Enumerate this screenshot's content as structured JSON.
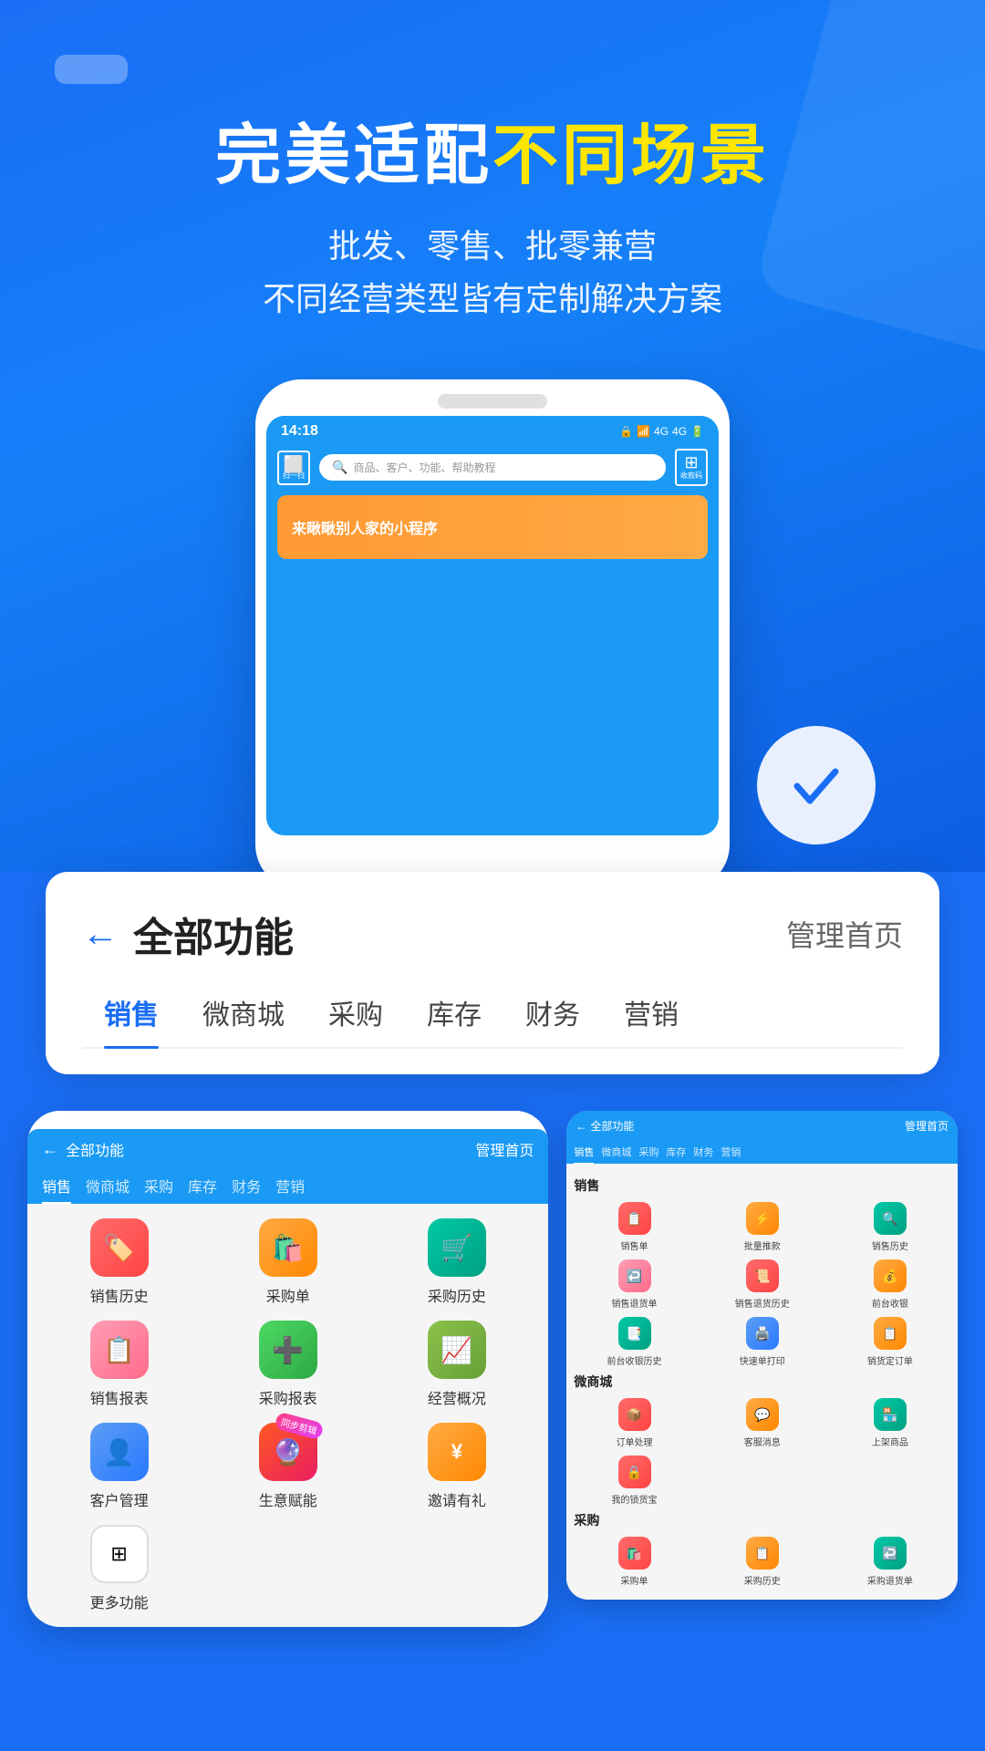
{
  "app": {
    "title": "完美适配不同场景"
  },
  "hero": {
    "headline_white": "完美适配",
    "headline_yellow": "不同场景",
    "subline1": "批发、零售、批零兼营",
    "subline2": "不同经营类型皆有定制解决方案"
  },
  "phone_mock": {
    "time": "14:18",
    "search_placeholder": "商品、客户、功能、帮助教程",
    "scan_label": "扫一扫",
    "qr_label": "收款码",
    "banner_text": "来瞅瞅别人家的小程序"
  },
  "feature_card": {
    "back_label": "←",
    "title": "全部功能",
    "manage_label": "管理首页",
    "tabs": [
      "销售",
      "微商城",
      "采购",
      "库存",
      "财务",
      "营销"
    ]
  },
  "icon_grid_left": {
    "items": [
      {
        "label": "销售历史",
        "icon": "🏷️",
        "color": "icon-red"
      },
      {
        "label": "采购单",
        "icon": "➕",
        "color": "icon-orange"
      },
      {
        "label": "采购历史",
        "icon": "🛒",
        "color": "icon-teal"
      },
      {
        "label": "销售报表",
        "icon": "📊",
        "color": "icon-pink"
      },
      {
        "label": "采购报表",
        "icon": "➕",
        "color": "icon-green"
      },
      {
        "label": "经营概况",
        "icon": "📈",
        "color": "icon-yellow-green"
      },
      {
        "label": "客户管理",
        "icon": "👤",
        "color": "icon-blue"
      },
      {
        "label": "生意赋能",
        "icon": "🔮",
        "color": "icon-special",
        "badge": "同步剪辑"
      },
      {
        "label": "邀请有礼",
        "icon": "¥",
        "color": "icon-orange"
      }
    ],
    "more_label": "更多功能"
  },
  "right_phone": {
    "nav_title": "全部功能",
    "manage_label": "管理首页",
    "tabs": [
      "销售",
      "微商城",
      "采购",
      "库存",
      "财务",
      "营销"
    ],
    "sections": [
      {
        "title": "销售",
        "items": [
          {
            "label": "销售单",
            "color": "icon-red"
          },
          {
            "label": "批量推款",
            "color": "icon-orange"
          },
          {
            "label": "销售历史",
            "color": "icon-teal"
          },
          {
            "label": "销售退货单",
            "color": "icon-pink"
          },
          {
            "label": "销售退货历史",
            "color": "icon-red"
          },
          {
            "label": "前台收银",
            "color": "icon-orange"
          },
          {
            "label": "前台收银历史",
            "color": "icon-teal"
          },
          {
            "label": "快速单打印",
            "color": "icon-blue"
          },
          {
            "label": "销货定订单",
            "color": "icon-orange"
          }
        ]
      },
      {
        "title": "微商城",
        "items": [
          {
            "label": "订单处理",
            "color": "icon-red"
          },
          {
            "label": "客服消息",
            "color": "icon-orange"
          },
          {
            "label": "上架商品",
            "color": "icon-teal"
          },
          {
            "label": "我的锁货宝",
            "color": "icon-red"
          }
        ]
      },
      {
        "title": "采购",
        "items": [
          {
            "label": "采购单",
            "color": "icon-red"
          },
          {
            "label": "采购历史",
            "color": "icon-orange"
          },
          {
            "label": "采购退货单",
            "color": "icon-teal"
          }
        ]
      }
    ]
  }
}
